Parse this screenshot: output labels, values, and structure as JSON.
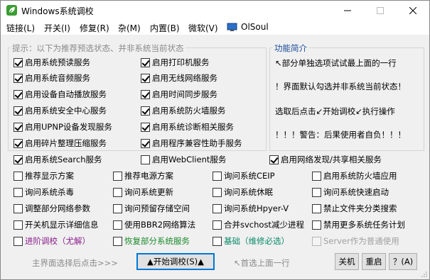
{
  "window": {
    "title": "Windows系统调校"
  },
  "menu": [
    {
      "label": "链接(L)"
    },
    {
      "label": "开关(I)"
    },
    {
      "label": "修复(R)"
    },
    {
      "label": "杂(M)"
    },
    {
      "label": "内置(B)"
    },
    {
      "label": "微软(V)"
    },
    {
      "label": "OlSoul"
    }
  ],
  "status_group": {
    "legend": "提示：以下为推荐预选状态、并非系统当前状态"
  },
  "intro": {
    "legend": "功能简介",
    "lines": [
      "↖部分单独选项试试最上面的一行",
      "！界面默认勾选并非系统当前状态！",
      "选取后点击↙开始调校↙执行操作",
      "！！！警告：后果使用者自负！！！"
    ]
  },
  "checkboxes": {
    "c1": {
      "label": "启用系统预读服务",
      "checked": true
    },
    "c2": {
      "label": "启用系统音频服务",
      "checked": true
    },
    "c3": {
      "label": "启用设备自动播放服务",
      "checked": true
    },
    "c4": {
      "label": "启用系统安全中心服务",
      "checked": true
    },
    "c5": {
      "label": "启用UPNP设备发现服务",
      "checked": true
    },
    "c6": {
      "label": "启用碎片整理压缩服务",
      "checked": true
    },
    "c7": {
      "label": "启用系统Search服务",
      "checked": true
    },
    "d1": {
      "label": "启用打印机服务",
      "checked": true
    },
    "d2": {
      "label": "启用无线网络服务",
      "checked": true
    },
    "d3": {
      "label": "启用时间同步服务",
      "checked": true
    },
    "d4": {
      "label": "启用系统防火墙服务",
      "checked": true
    },
    "d5": {
      "label": "启用系统诊断相关服务",
      "checked": true
    },
    "d6": {
      "label": "启用程序兼容性助手服务",
      "checked": true
    },
    "d7": {
      "label": "启用WebClient服务",
      "checked": false
    },
    "e7": {
      "label": "启用网络发现/共享相关服务",
      "checked": true
    },
    "r1": {
      "label": "推荐显示方案",
      "checked": false
    },
    "r2": {
      "label": "推荐电源方案",
      "checked": false
    },
    "r3": {
      "label": "询问系统CEIP",
      "checked": false
    },
    "r4": {
      "label": "启用系统防火墙应用",
      "checked": false
    },
    "s1": {
      "label": "询问系统杀毒",
      "checked": false
    },
    "s2": {
      "label": "询问系统更新",
      "checked": false
    },
    "s3": {
      "label": "询问系统休眠",
      "checked": false
    },
    "s4": {
      "label": "询问系统快速启动",
      "checked": false
    },
    "t1": {
      "label": "调整部分网络参数",
      "checked": false
    },
    "t2": {
      "label": "询问预留存储空间",
      "checked": false
    },
    "t3": {
      "label": "询问系统Hpyer-V",
      "checked": false
    },
    "t4": {
      "label": "禁止文件夹分类搜索",
      "checked": false
    },
    "u1": {
      "label": "开关机显示详细信息",
      "checked": false
    },
    "u2": {
      "label": "使用BBR2网络算法",
      "checked": false
    },
    "u3": {
      "label": "合并svchost减少进程",
      "checked": false
    },
    "u4": {
      "label": "禁用更多系统任务计划",
      "checked": false
    },
    "v1": {
      "label": "进阶调校（尤解）",
      "checked": false
    },
    "v2": {
      "label": "恢复部分系统服务",
      "checked": false
    },
    "v3": {
      "label": "基础（维修必选）",
      "checked": false
    },
    "v4": {
      "label": "Server作为普通使用",
      "checked": false
    }
  },
  "bottom": {
    "hint_left": "主界面选择后点击>>>",
    "start_button": "▲开始调校(S)▲",
    "hint_right": "↖首选上面一行",
    "shutdown_button": "关机",
    "restart_button": "重启",
    "help_button": "？(A)"
  },
  "colors": {
    "purple_label": "#8b1e8b",
    "green_label": "#1a8a2a",
    "teal_label": "#0a8a6a",
    "disabled_label": "#a0a0a0",
    "accent": "#0078d7"
  }
}
